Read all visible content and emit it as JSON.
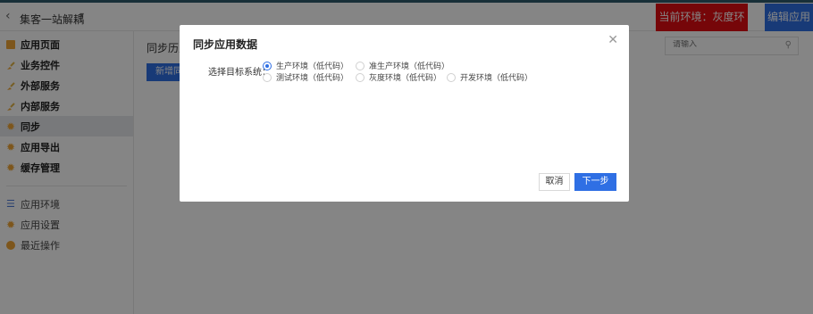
{
  "header": {
    "back_icon": "chevron-left-icon",
    "app_name": "集客一站解耦",
    "env_label": "当前环境：灰度环境",
    "edit_label": "编辑应用",
    "colors": {
      "env": "#e30d13",
      "edit": "#2f6fe4"
    }
  },
  "sidebar": {
    "items": [
      {
        "label": "应用页面",
        "icon": "document-icon"
      },
      {
        "label": "业务控件",
        "icon": "brush-icon"
      },
      {
        "label": "外部服务",
        "icon": "brush-icon"
      },
      {
        "label": "内部服务",
        "icon": "brush-icon"
      },
      {
        "label": "同步",
        "icon": "gear-icon",
        "active": true
      },
      {
        "label": "应用导出",
        "icon": "gear-icon"
      },
      {
        "label": "缓存管理",
        "icon": "gear-icon"
      }
    ],
    "secondary_items": [
      {
        "label": "应用环境",
        "icon": "database-icon"
      },
      {
        "label": "应用设置",
        "icon": "gear-icon"
      },
      {
        "label": "最近操作",
        "icon": "clock-icon"
      }
    ]
  },
  "main": {
    "title": "同步历史",
    "new_button": "新增同",
    "search": {
      "placeholder": "请输入",
      "icon": "search-icon"
    }
  },
  "modal": {
    "title": "同步应用数据",
    "close_icon": "close-icon",
    "field_label": "选择目标系统：",
    "options": [
      {
        "label": "生产环境（低代码）",
        "checked": true
      },
      {
        "label": "准生产环境（低代码）",
        "checked": false
      },
      {
        "label": "测试环境（低代码）",
        "checked": false
      },
      {
        "label": "灰度环境（低代码）",
        "checked": false
      },
      {
        "label": "开发环境（低代码）",
        "checked": false
      }
    ],
    "cancel_label": "取消",
    "next_label": "下一步"
  }
}
